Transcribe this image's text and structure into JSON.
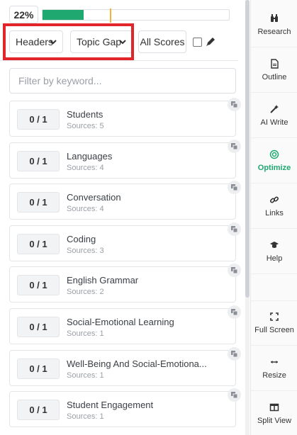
{
  "score": {
    "label": "22%",
    "progress_fraction": 0.22,
    "marker_fraction": 0.36
  },
  "toolbar": {
    "headers_label": "Headers",
    "topic_label": "Topic Gap",
    "all_scores_label": "All Scores"
  },
  "filter": {
    "placeholder": "Filter by keyword..."
  },
  "topics": [
    {
      "count": "0 / 1",
      "title": "Students",
      "sources": "Sources: 5"
    },
    {
      "count": "0 / 1",
      "title": "Languages",
      "sources": "Sources: 4"
    },
    {
      "count": "0 / 1",
      "title": "Conversation",
      "sources": "Sources: 4"
    },
    {
      "count": "0 / 1",
      "title": "Coding",
      "sources": "Sources: 3"
    },
    {
      "count": "0 / 1",
      "title": "English Grammar",
      "sources": "Sources: 2"
    },
    {
      "count": "0 / 1",
      "title": "Social-Emotional Learning",
      "sources": "Sources: 1"
    },
    {
      "count": "0 / 1",
      "title": "Well-Being And Social-Emotiona...",
      "sources": "Sources: 1"
    },
    {
      "count": "0 / 1",
      "title": "Student Engagement",
      "sources": "Sources: 1"
    }
  ],
  "sidebar": {
    "items": [
      {
        "label": "Research",
        "icon": "binoculars-icon"
      },
      {
        "label": "Outline",
        "icon": "document-icon"
      },
      {
        "label": "AI Write",
        "icon": "magic-wand-icon"
      },
      {
        "label": "Optimize",
        "icon": "target-icon",
        "active": true
      },
      {
        "label": "Links",
        "icon": "link-icon"
      },
      {
        "label": "Help",
        "icon": "graduation-cap-icon"
      },
      {
        "label": "Full Screen",
        "icon": "expand-icon"
      },
      {
        "label": "Resize",
        "icon": "resize-arrows-icon"
      },
      {
        "label": "Split View",
        "icon": "split-view-icon"
      }
    ]
  },
  "colors": {
    "accent": "#1fa971",
    "highlight": "#e1252b",
    "marker": "#f5b335"
  }
}
